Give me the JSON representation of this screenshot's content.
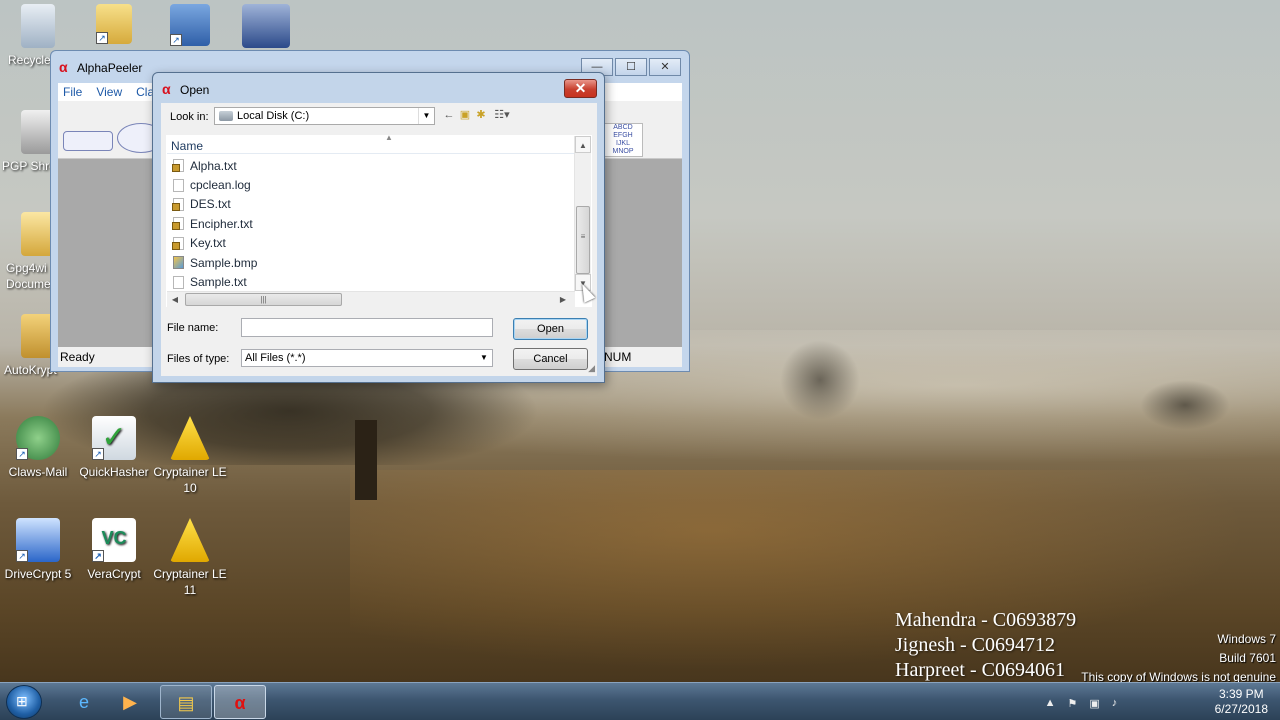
{
  "desktop": {
    "icons": [
      {
        "label": "Recycle",
        "x_hint": "recycle"
      },
      {
        "label": "PGP Shre",
        "x_hint": "pgp"
      },
      {
        "label": "Gpg4wi Docume",
        "x_hint": "gpg"
      },
      {
        "label": "AutoKrypt",
        "x_hint": "autokrypt"
      },
      {
        "label": "Claws-Mail",
        "x_hint": "claws"
      },
      {
        "label": "QuickHasher",
        "x_hint": "quickhasher"
      },
      {
        "label": "Cryptainer LE 10",
        "x_hint": "cryptainer10"
      },
      {
        "label": "DriveCrypt 5",
        "x_hint": "drivecrypt"
      },
      {
        "label": "VeraCrypt",
        "x_hint": "veracrypt"
      },
      {
        "label": "Cryptainer LE 11",
        "x_hint": "cryptainer11"
      }
    ]
  },
  "alphapeeler": {
    "title": "AlphaPeeler",
    "menu": [
      "File",
      "View",
      "Classi"
    ],
    "status": "Ready",
    "num": "NUM"
  },
  "dialog": {
    "title": "Open",
    "lookin_label": "Look in:",
    "lookin_value": "Local Disk (C:)",
    "column_name": "Name",
    "files": [
      {
        "name": "Alpha.txt",
        "icon": "locked-file"
      },
      {
        "name": "cpclean.log",
        "icon": "file"
      },
      {
        "name": "DES.txt",
        "icon": "locked-file"
      },
      {
        "name": "Encipher.txt",
        "icon": "locked-file"
      },
      {
        "name": "Key.txt",
        "icon": "locked-file"
      },
      {
        "name": "Sample.bmp",
        "icon": "bitmap-file"
      },
      {
        "name": "Sample.txt",
        "icon": "file"
      }
    ],
    "filename_label": "File name:",
    "filename_value": "",
    "filetype_label": "Files of type:",
    "filetype_value": "All Files (*.*)",
    "open_button": "Open",
    "cancel_button": "Cancel"
  },
  "watermark": {
    "names": [
      "Mahendra - C0693879",
      "Jignesh - C0694712",
      "Harpreet - C0694061"
    ],
    "windows_line1": "Windows 7",
    "windows_line2": "Build 7601",
    "windows_line3": "This copy of Windows is not genuine"
  },
  "taskbar": {
    "time": "3:39 PM",
    "date": "6/27/2018"
  }
}
